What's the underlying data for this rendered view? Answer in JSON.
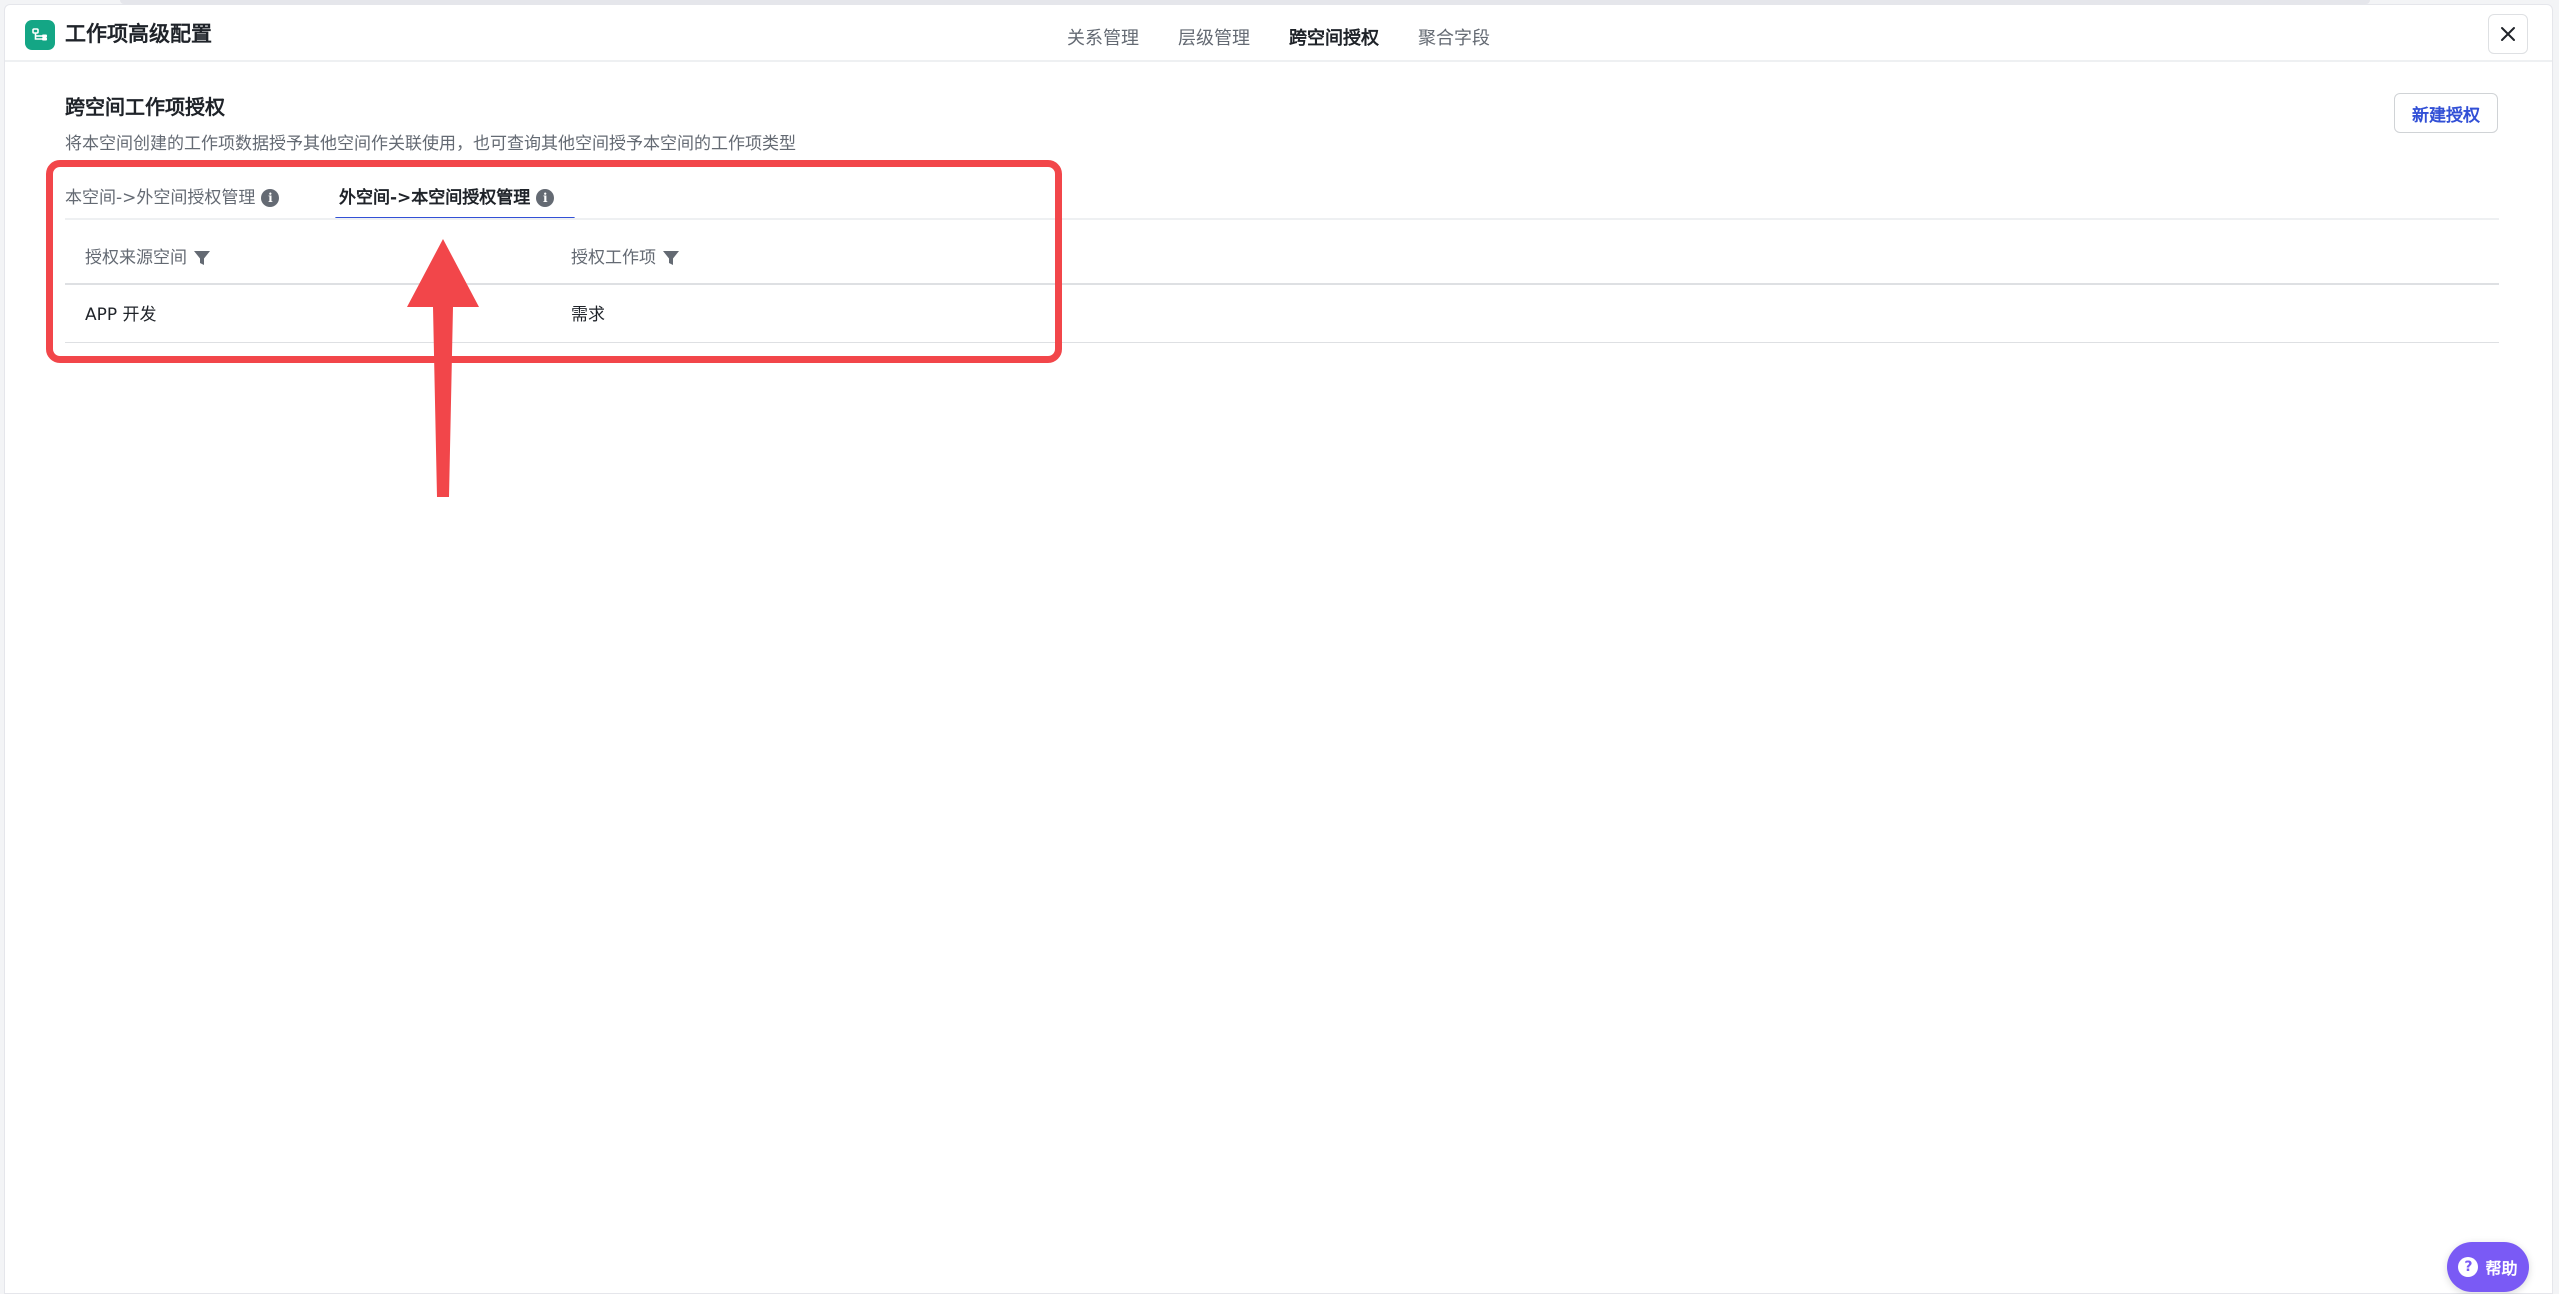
{
  "header": {
    "app_title": "工作项高级配置",
    "tabs": [
      {
        "label": "关系管理",
        "active": false
      },
      {
        "label": "层级管理",
        "active": false
      },
      {
        "label": "跨空间授权",
        "active": true
      },
      {
        "label": "聚合字段",
        "active": false
      }
    ]
  },
  "section": {
    "title": "跨空间工作项授权",
    "description": "将本空间创建的工作项数据授予其他空间作关联使用，也可查询其他空间授予本空间的工作项类型",
    "new_button": "新建授权"
  },
  "sub_tabs": [
    {
      "label": "本空间->外空间授权管理",
      "active": false
    },
    {
      "label": "外空间->本空间授权管理",
      "active": true
    }
  ],
  "table": {
    "columns": [
      "授权来源空间",
      "授权工作项"
    ],
    "rows": [
      [
        "APP 开发",
        "需求"
      ]
    ]
  },
  "help": {
    "label": "帮助"
  },
  "colors": {
    "accent": "#3250d6",
    "app_icon": "#14a685",
    "annotation": "#f2464a",
    "help": "#7a5af5"
  }
}
